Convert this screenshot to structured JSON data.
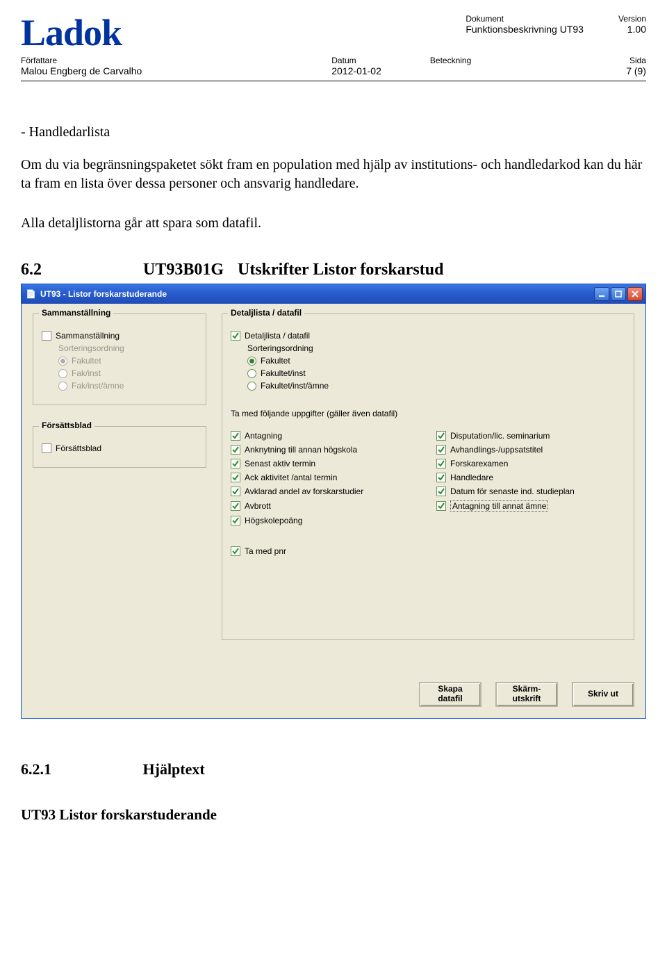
{
  "header": {
    "logo": "Ladok",
    "dokument_label": "Dokument",
    "dokument_val": "Funktionsbeskrivning UT93",
    "version_label": "Version",
    "version_val": "1.00",
    "forfattare_label": "Författare",
    "forfattare_val": "Malou Engberg de Carvalho",
    "datum_label": "Datum",
    "datum_val": "2012-01-02",
    "beteckning_label": "Beteckning",
    "sida_label": "Sida",
    "sida_val": "7 (9)"
  },
  "body": {
    "p1": "- Handledarlista",
    "p2": "Om du via begränsningspaketet sökt fram en population med hjälp av institutions- och handledarkod kan du här ta fram en lista över dessa personer och ansvarig handledare.",
    "p3": "Alla detaljlistorna går att spara som datafil.",
    "sec6_2_num": "6.2",
    "sec6_2_code": "UT93B01G",
    "sec6_2_title": "Utskrifter Listor forskarstud",
    "sec6_2_1_num": "6.2.1",
    "sec6_2_1_title": "Hjälptext",
    "footer_h": "UT93 Listor forskarstuderande"
  },
  "dialog": {
    "title": "UT93 - Listor forskarstuderande",
    "samman_title": "Sammanställning",
    "samman_chk": "Sammanställning",
    "sortord": "Sorteringsordning",
    "r_fakultet": "Fakultet",
    "r_fakinst": "Fak/inst",
    "r_fakinstamne": "Fak/inst/ämne",
    "forsatts_title": "Försättsblad",
    "forsatts_chk": "Försättsblad",
    "detalj_title": "Detaljlista / datafil",
    "detalj_chk": "Detaljlista / datafil",
    "r2_fakultet": "Fakultet",
    "r2_fakinst": "Fakultet/inst",
    "r2_fakinstamne": "Fakultet/inst/ämne",
    "take_head": "Ta med följande uppgifter (gäller även datafil)",
    "opts_left": [
      "Antagning",
      "Anknytning till annan högskola",
      "Senast aktiv termin",
      "Ack aktivitet /antal termin",
      "Avklarad andel av forskarstudier",
      "Avbrott",
      "Högskolepoäng"
    ],
    "opts_right": [
      "Disputation/lic. seminarium",
      "Avhandlings-/uppsatstitel",
      "Forskarexamen",
      "Handledare",
      "Datum för senaste ind. studieplan",
      "Antagning till annat ämne"
    ],
    "pnr": "Ta med pnr",
    "btn_datafil": "Skapa\ndatafil",
    "btn_skarm": "Skärm-\nutskrift",
    "btn_print": "Skriv ut"
  }
}
